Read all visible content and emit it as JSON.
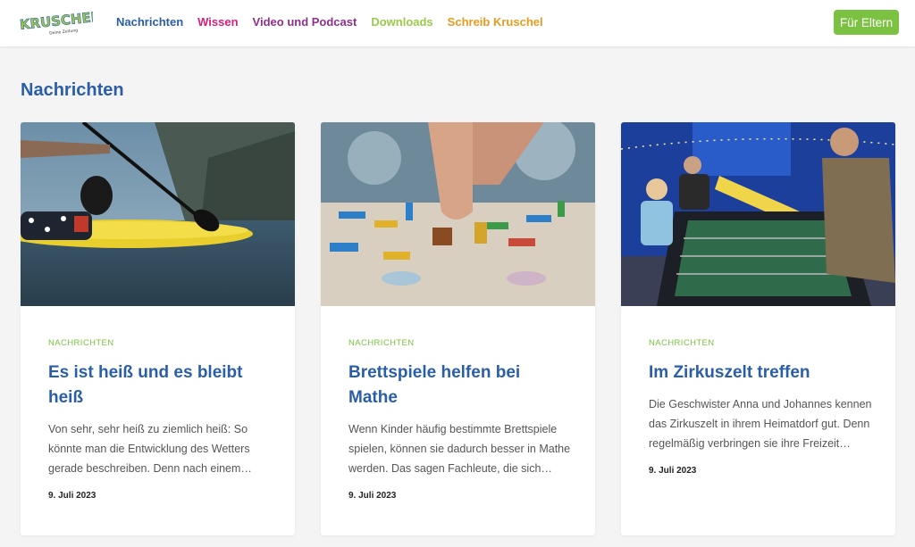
{
  "colors": {
    "brand_blue": "#2a5ea8",
    "brand_green": "#7cc242",
    "magenta": "#d6207a",
    "purple": "#8e2f8e",
    "orange": "#e89a1e",
    "light_green": "#9bc94a"
  },
  "header": {
    "logo_text": "KRUSCHEL",
    "logo_tagline": "Deine Zeitung",
    "nav": [
      {
        "label": "Nachrichten",
        "color": "#2a5ea8"
      },
      {
        "label": "Wissen",
        "color": "#d6207a"
      },
      {
        "label": "Video und Podcast",
        "color": "#8e2f8e"
      },
      {
        "label": "Downloads",
        "color": "#9bc94a"
      },
      {
        "label": "Schreib Kruschel",
        "color": "#e89a1e"
      }
    ],
    "parents_button": "Für Eltern"
  },
  "section": {
    "title": "Nachrichten"
  },
  "cards": [
    {
      "image_icon": "paddleboard-dog-photo",
      "category": "NACHRICHTEN",
      "title": "Es ist heiß und es bleibt heiß",
      "excerpt": "Von sehr, sehr heiß zu ziemlich heiß: So könnte man die Entwicklung des Wetters gerade beschreiben. Denn nach einem…",
      "date": "9. Juli 2023"
    },
    {
      "image_icon": "board-game-photo",
      "category": "NACHRICHTEN",
      "title": "Brettspiele helfen bei Mathe",
      "excerpt": "Wenn Kinder häufig bestimmte Brettspiele spielen, können sie dadurch besser in Mathe werden. Das sagen Fachleute, die sich…",
      "date": "9. Juli 2023"
    },
    {
      "image_icon": "circus-tent-foosball-photo",
      "category": "NACHRICHTEN",
      "title": "Im Zirkuszelt treffen",
      "excerpt": "Die Geschwister Anna und Johannes kennen das Zirkuszelt in ihrem Heimatdorf gut. Denn regelmäßig verbringen sie ihre Freizeit…",
      "date": "9. Juli 2023"
    }
  ]
}
